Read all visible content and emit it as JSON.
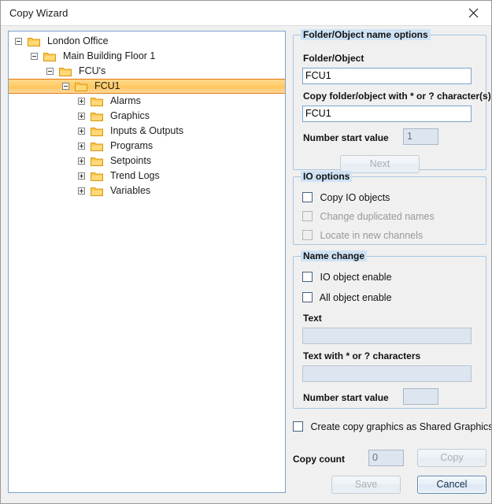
{
  "window": {
    "title": "Copy Wizard",
    "close_icon": "close-icon"
  },
  "tree": {
    "nodes": [
      {
        "label": "London Office",
        "depth": 0,
        "state": "expanded",
        "selected": false
      },
      {
        "label": "Main Building  Floor 1",
        "depth": 1,
        "state": "expanded",
        "selected": false
      },
      {
        "label": "FCU's",
        "depth": 2,
        "state": "expanded",
        "selected": false
      },
      {
        "label": "FCU1",
        "depth": 3,
        "state": "expanded",
        "selected": true
      },
      {
        "label": "Alarms",
        "depth": 4,
        "state": "collapsed",
        "selected": false
      },
      {
        "label": "Graphics",
        "depth": 4,
        "state": "collapsed",
        "selected": false
      },
      {
        "label": "Inputs & Outputs",
        "depth": 4,
        "state": "collapsed",
        "selected": false
      },
      {
        "label": "Programs",
        "depth": 4,
        "state": "collapsed",
        "selected": false
      },
      {
        "label": "Setpoints",
        "depth": 4,
        "state": "collapsed",
        "selected": false
      },
      {
        "label": "Trend Logs",
        "depth": 4,
        "state": "collapsed",
        "selected": false
      },
      {
        "label": "Variables",
        "depth": 4,
        "state": "collapsed",
        "selected": false
      }
    ]
  },
  "folder_object_options": {
    "group_title": "Folder/Object name options",
    "name_label": "Folder/Object",
    "name_value": "FCU1",
    "pattern_label": "Copy folder/object with * or ? character(s)",
    "pattern_value": "FCU1",
    "number_start_label": "Number start value",
    "number_start_value": "1",
    "next_button": "Next"
  },
  "io_options": {
    "group_title": "IO options",
    "copy_io_objects": "Copy IO objects",
    "change_duplicated_names": "Change duplicated names",
    "locate_in_new_channels": "Locate in new channels"
  },
  "name_change": {
    "group_title": "Name change",
    "io_object_enable": "IO object enable",
    "all_object_enable": "All object enable",
    "text_label": "Text",
    "text_value": "",
    "text_pattern_label": "Text with * or ? characters",
    "text_pattern_value": "",
    "number_start_label": "Number start value",
    "number_start_value": ""
  },
  "shared_graphics": {
    "label": "Create copy graphics as Shared Graphics"
  },
  "footer": {
    "copy_count_label": "Copy count",
    "copy_count_value": "0",
    "copy_button": "Copy",
    "save_button": "Save",
    "cancel_button": "Cancel"
  },
  "colors": {
    "selection_orange": "#ffc559",
    "group_title_bg": "#cfe2f5",
    "panel_border": "#7aa4d0",
    "dialog_bg": "#f0f0f0"
  }
}
